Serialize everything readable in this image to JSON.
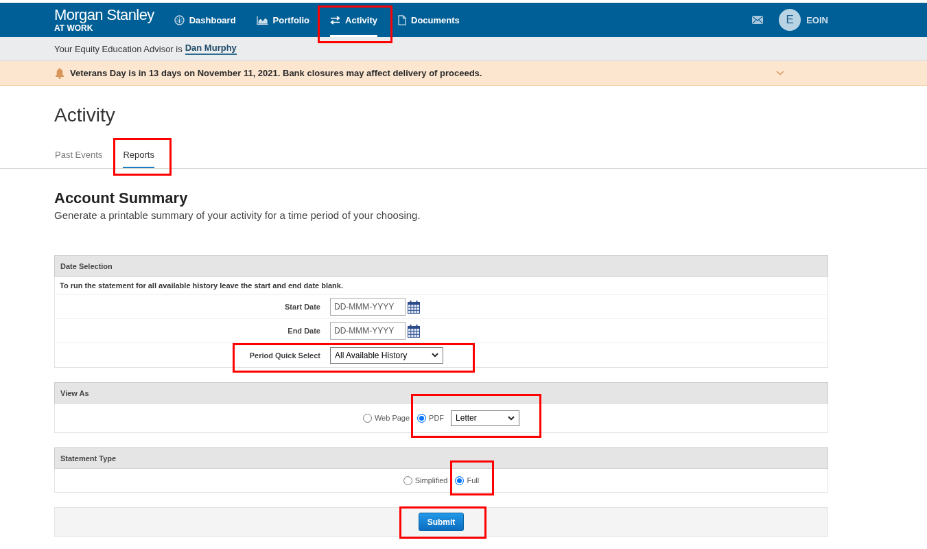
{
  "header": {
    "logo": {
      "name": "Morgan Stanley",
      "tagline": "AT WORK"
    },
    "nav": [
      {
        "label": "Dashboard",
        "selected": false,
        "highlighted": false
      },
      {
        "label": "Portfolio",
        "selected": false,
        "highlighted": false
      },
      {
        "label": "Activity",
        "selected": true,
        "highlighted": true
      },
      {
        "label": "Documents",
        "selected": false,
        "highlighted": false
      }
    ],
    "user": {
      "initial": "E",
      "name": "EOIN"
    }
  },
  "advisor_bar": {
    "text": "Your Equity Education Advisor is",
    "advisor": "Dan Murphy"
  },
  "alert": {
    "message": "Veterans Day is in 13 days on November 11, 2021. Bank closures may affect delivery of proceeds.",
    "expanded": false
  },
  "page_title": "Activity",
  "tabs": [
    {
      "label": "Past Events",
      "selected": false,
      "highlighted": false
    },
    {
      "label": "Reports",
      "selected": true,
      "highlighted": true
    }
  ],
  "report": {
    "title": "Account Summary",
    "description": "Generate a printable summary of your activity for a time period of your choosing."
  },
  "date_selection": {
    "heading": "Date Selection",
    "note": "To run the statement for all available history leave the start and end date blank.",
    "fields": [
      {
        "kind": "date",
        "label": "Start Date",
        "placeholder": "DD-MMM-YYYY",
        "highlighted": false
      },
      {
        "kind": "date",
        "label": "End Date",
        "placeholder": "DD-MMM-YYYY",
        "highlighted": false
      },
      {
        "kind": "select",
        "label": "Period Quick Select",
        "value": "All Available History",
        "highlighted": true
      }
    ]
  },
  "view_as": {
    "heading": "View As",
    "options": [
      {
        "label": "Web Page",
        "selected": false,
        "highlighted": false
      },
      {
        "label": "PDF",
        "selected": true,
        "highlighted": true,
        "paper_size": "Letter"
      }
    ]
  },
  "statement_type": {
    "heading": "Statement Type",
    "options": [
      {
        "label": "Simplified",
        "selected": false,
        "highlighted": false
      },
      {
        "label": "Full",
        "selected": true,
        "highlighted": true
      }
    ]
  },
  "submit": {
    "label": "Submit",
    "highlighted": true
  }
}
